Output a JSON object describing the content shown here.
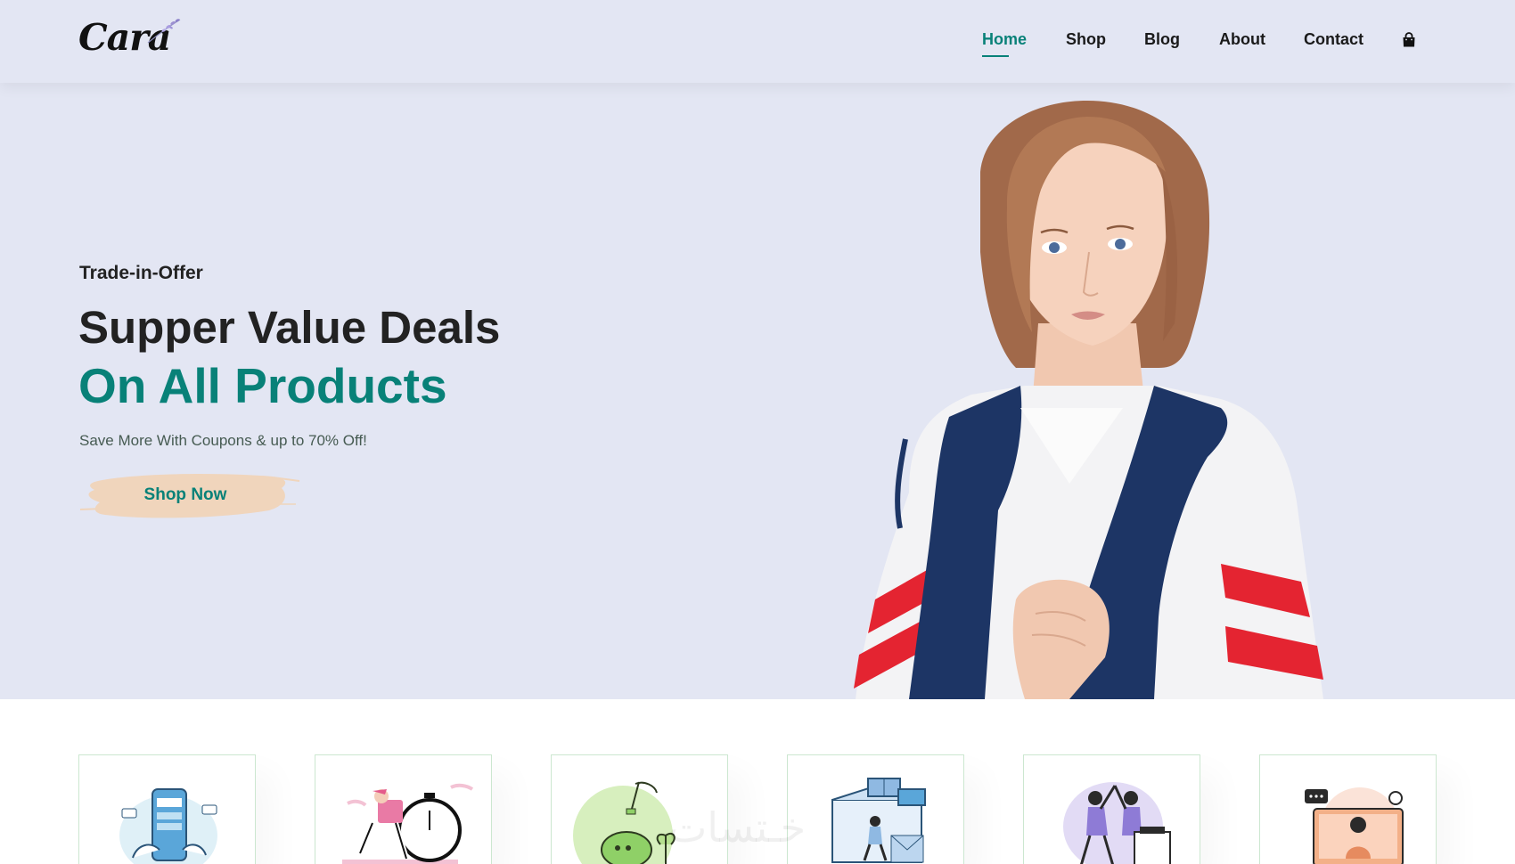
{
  "brand": {
    "logo_text": "Cara"
  },
  "nav": {
    "items": [
      {
        "label": "Home",
        "active": true
      },
      {
        "label": "Shop",
        "active": false
      },
      {
        "label": "Blog",
        "active": false
      },
      {
        "label": "About",
        "active": false
      },
      {
        "label": "Contact",
        "active": false
      }
    ],
    "cart_icon": "shopping-bag-icon"
  },
  "hero": {
    "subtitle": "Trade-in-Offer",
    "title_line1": "Supper Value Deals",
    "title_line2": "On All Products",
    "description": "Save More With Coupons & up to 70% Off!",
    "cta_label": "Shop Now"
  },
  "features": [
    {
      "icon": "mobile-payment-illustration"
    },
    {
      "icon": "fast-delivery-illustration"
    },
    {
      "icon": "savings-piggy-bank-illustration"
    },
    {
      "icon": "promotions-illustration"
    },
    {
      "icon": "happy-sell-illustration"
    },
    {
      "icon": "online-support-illustration"
    }
  ],
  "watermark_text": "خـتسات",
  "colors": {
    "accent": "#088178",
    "header_bg": "#e3e6f3",
    "button_brush": "#f0d5bc",
    "text_dark": "#222222"
  }
}
